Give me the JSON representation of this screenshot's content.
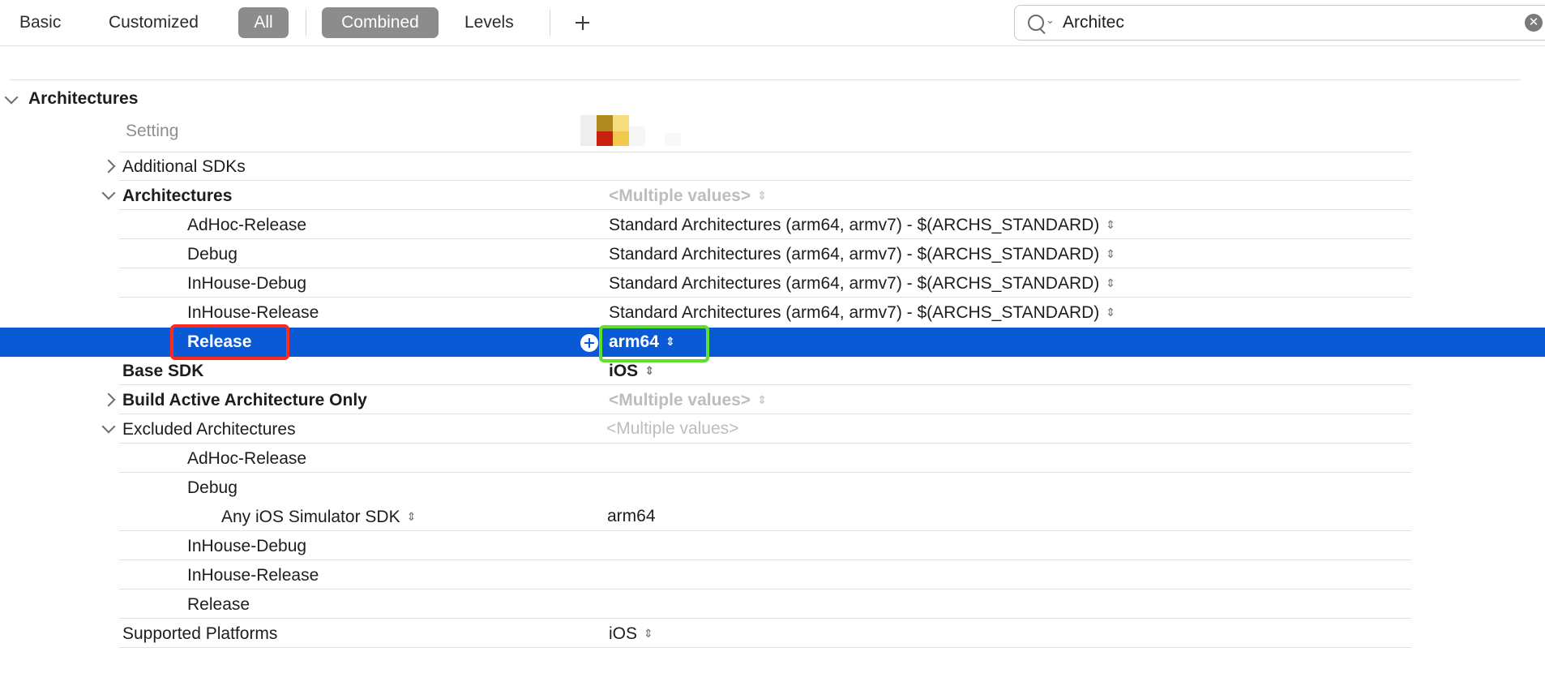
{
  "toolbar": {
    "tabs": [
      "Basic",
      "Customized",
      "All",
      "Combined",
      "Levels"
    ],
    "add_label": "+"
  },
  "search": {
    "value": "Architec",
    "caret": "⌄",
    "clear": "✕"
  },
  "section": {
    "title": "Architectures"
  },
  "header": {
    "setting_label": "Setting"
  },
  "rows": {
    "additional_sdks": {
      "label": "Additional SDKs"
    },
    "architectures": {
      "label": "Architectures",
      "value": "<Multiple values>"
    },
    "arch_adhoc_release": {
      "label": "AdHoc-Release",
      "value": "Standard Architectures (arm64, armv7)  -  $(ARCHS_STANDARD)"
    },
    "arch_debug": {
      "label": "Debug",
      "value": "Standard Architectures (arm64, armv7)  -  $(ARCHS_STANDARD)"
    },
    "arch_inhouse_debug": {
      "label": "InHouse-Debug",
      "value": "Standard Architectures (arm64, armv7)  -  $(ARCHS_STANDARD)"
    },
    "arch_inhouse_release": {
      "label": "InHouse-Release",
      "value": "Standard Architectures (arm64, armv7)  -  $(ARCHS_STANDARD)"
    },
    "arch_release": {
      "label": "Release",
      "value": "arm64"
    },
    "base_sdk": {
      "label": "Base SDK",
      "value": "iOS"
    },
    "build_active_arch": {
      "label": "Build Active Architecture Only",
      "value": "<Multiple values>"
    },
    "excluded_archs": {
      "label": "Excluded Architectures",
      "value": "<Multiple values>"
    },
    "ex_adhoc_release": {
      "label": "AdHoc-Release"
    },
    "ex_debug": {
      "label": "Debug"
    },
    "ex_any_ios_sim": {
      "label": "Any iOS Simulator SDK",
      "value": "arm64"
    },
    "ex_inhouse_debug": {
      "label": "InHouse-Debug"
    },
    "ex_inhouse_release": {
      "label": "InHouse-Release"
    },
    "ex_release": {
      "label": "Release"
    },
    "supported_platforms": {
      "label": "Supported Platforms",
      "value": "iOS"
    }
  },
  "colors": {
    "selection": "#0a5ad6",
    "highlight_red": "#ff2a1d",
    "highlight_green": "#5fe02a",
    "pill": "#8c8c8c"
  },
  "icons": {
    "updown": "⌃⌄",
    "chevron_right": "chevron-right-icon",
    "chevron_down": "chevron-down-icon"
  }
}
